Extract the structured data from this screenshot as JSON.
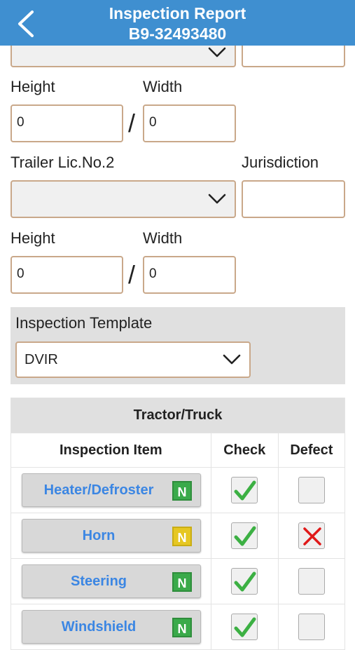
{
  "header": {
    "title": "Inspection Report",
    "subtitle": "B9-32493480",
    "back_icon": "chevron-left-icon"
  },
  "trailer1": {
    "height_label": "Height",
    "width_label": "Width",
    "height_value": "0",
    "width_value": "0",
    "separator": "/"
  },
  "trailer2": {
    "lic_label": "Trailer Lic.No.2",
    "jurisdiction_label": "Jurisdiction",
    "height_label": "Height",
    "width_label": "Width",
    "height_value": "0",
    "width_value": "0",
    "separator": "/"
  },
  "template": {
    "label": "Inspection Template",
    "selected": "DVIR"
  },
  "table": {
    "title": "Tractor/Truck",
    "columns": [
      "Inspection Item",
      "Check",
      "Defect"
    ],
    "rows": [
      {
        "item": "Heater/Defroster",
        "badge": "N",
        "badge_color": "#3aaa4a",
        "check": true,
        "defect": false
      },
      {
        "item": "Horn",
        "badge": "N",
        "badge_color": "#e6c722",
        "check": true,
        "defect": true
      },
      {
        "item": "Steering",
        "badge": "N",
        "badge_color": "#3aaa4a",
        "check": true,
        "defect": false
      },
      {
        "item": "Windshield",
        "badge": "N",
        "badge_color": "#3aaa4a",
        "check": true,
        "defect": false
      }
    ]
  },
  "colors": {
    "header_bg": "#3f8fd0",
    "link_blue": "#3b86e3",
    "check_green": "#3cb043",
    "defect_red": "#e01919"
  }
}
